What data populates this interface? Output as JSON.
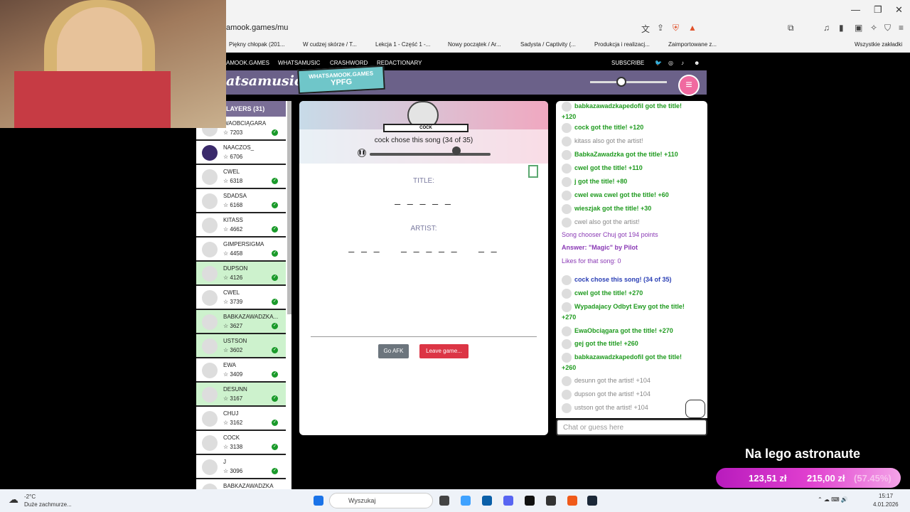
{
  "window": {
    "min": "—",
    "max": "❐",
    "close": "✕"
  },
  "browser": {
    "url": "amook.games/mu",
    "bookmarks": [
      "Piękny chłopak (201...",
      "W cudzej skórze / T...",
      "Lekcja 1 - Część 1 -...",
      "Nowy początek / Ar...",
      "Sadysta / Captivity (...",
      "Produkcja i realizacj...",
      "Zaimportowane z...",
      "Wszystkie zakładki"
    ]
  },
  "site": {
    "nav": [
      "AMOOK.GAMES",
      "WHATSAMUSIC",
      "CRASHWORD",
      "REDACTIONARY"
    ],
    "subscribe": "SUBSCRIBE",
    "logo": "atsamusic",
    "tag_top": "WHATSAMOOK.GAMES",
    "tag_bottom": "YPFG"
  },
  "players": {
    "header": "LAYERS (31)",
    "list": [
      {
        "name": "WAOBCIĄGARA",
        "score": "7203",
        "check": true,
        "green": false
      },
      {
        "name": "NAACZOS_",
        "score": "6706",
        "check": false,
        "green": false
      },
      {
        "name": "CWEL",
        "score": "6318",
        "check": true,
        "green": false
      },
      {
        "name": "SDADSA",
        "score": "6168",
        "check": true,
        "green": false
      },
      {
        "name": "KITASS",
        "score": "4662",
        "check": true,
        "green": false
      },
      {
        "name": "GIMPERSIGMA",
        "score": "4458",
        "check": true,
        "green": false
      },
      {
        "name": "DUPSON",
        "score": "4126",
        "check": true,
        "green": true
      },
      {
        "name": "CWEL",
        "score": "3739",
        "check": true,
        "green": false
      },
      {
        "name": "BABKAZAWADZKA...",
        "score": "3627",
        "check": true,
        "green": true
      },
      {
        "name": "USTSON",
        "score": "3602",
        "check": true,
        "green": true
      },
      {
        "name": "EWA",
        "score": "3409",
        "check": true,
        "green": false
      },
      {
        "name": "DESUNN",
        "score": "3167",
        "check": true,
        "green": true
      },
      {
        "name": "CHUJ",
        "score": "3162",
        "check": true,
        "green": false
      },
      {
        "name": "COCK",
        "score": "3138",
        "check": true,
        "green": false
      },
      {
        "name": "J",
        "score": "3096",
        "check": true,
        "green": false
      },
      {
        "name": "BABKAZAWADZKA",
        "score": "",
        "check": false,
        "green": false
      }
    ]
  },
  "game": {
    "chooser": "COCK",
    "chose": "cock chose this song (34 of 35)",
    "progress": 0.72,
    "title_label": "TITLE:",
    "title_blanks": "_ _ _ _ _",
    "artist_label": "ARTIST:",
    "artist_blanks": "_ _ _    _ _ _ _ _    _ _",
    "afk": "Go AFK",
    "leave": "Leave game..."
  },
  "chat": {
    "lines": [
      {
        "t": "babkazawadzkapedofil got the title! +120",
        "c": "green"
      },
      {
        "t": "cock got the title! +120",
        "c": "green"
      },
      {
        "t": "kitass also got the artist!",
        "c": "grey"
      },
      {
        "t": "BabkaZawadzka got the title! +110",
        "c": "green"
      },
      {
        "t": "cwel got the title! +110",
        "c": "green"
      },
      {
        "t": "j got the title! +80",
        "c": "green"
      },
      {
        "t": "cwel ewa cwel got the title! +60",
        "c": "green"
      },
      {
        "t": "wieszjak got the title! +30",
        "c": "green"
      },
      {
        "t": "cwel also got the artist!",
        "c": "grey"
      },
      {
        "t": "Song chooser Chuj got 194 points",
        "c": "purple"
      },
      {
        "t": "Answer: \"Magic\" by Pilot",
        "c": "purpleb"
      },
      {
        "t": "Likes for that song: 0",
        "c": "purple"
      },
      {
        "t": "cock chose this song! (34 of 35)",
        "c": "blue"
      },
      {
        "t": "cwel got the title! +270",
        "c": "green"
      },
      {
        "t": "Wypadajacy Odbyt Ewy got the title! +270",
        "c": "green"
      },
      {
        "t": "EwaObciągara got the title! +270",
        "c": "green"
      },
      {
        "t": "gej got the title! +260",
        "c": "green"
      },
      {
        "t": "babkazawadzkapedofil got the title! +260",
        "c": "green"
      },
      {
        "t": "desunn got the artist! +104",
        "c": "grey"
      },
      {
        "t": "dupson got the artist! +104",
        "c": "grey"
      },
      {
        "t": "ustson got the artist! +104",
        "c": "grey"
      }
    ],
    "placeholder": "Chat or guess here"
  },
  "overlay": {
    "title": "Na lego astronaute",
    "price1": "123,51 zł",
    "price2": "215,00 zł",
    "pct": "(57.45%)"
  },
  "taskbar": {
    "temp": "-2°C",
    "weather": "Duże zachmurze...",
    "search": "Wyszukaj",
    "time": "15:17",
    "date": "4.01.2026"
  }
}
